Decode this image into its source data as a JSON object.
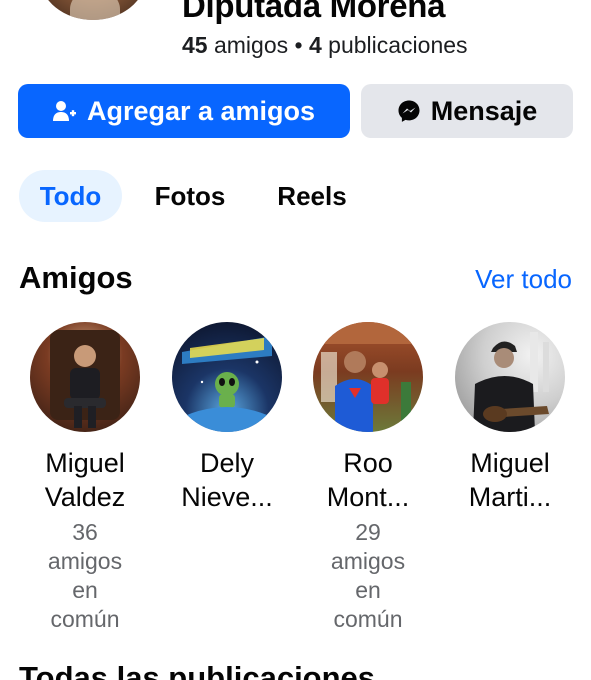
{
  "profile": {
    "name": "Diputada Morena",
    "friends_count": "45",
    "friends_label": "amigos",
    "separator": "•",
    "posts_count": "4",
    "posts_label": "publicaciones"
  },
  "actions": {
    "add_friend_label": "Agregar a amigos",
    "message_label": "Mensaje",
    "add_friend_icon": "add-friend-icon",
    "message_icon": "messenger-icon",
    "accent_color": "#0866ff"
  },
  "tabs": [
    {
      "label": "Todo",
      "active": true
    },
    {
      "label": "Fotos",
      "active": false
    },
    {
      "label": "Reels",
      "active": false
    }
  ],
  "friends_section": {
    "title": "Amigos",
    "see_all": "Ver todo",
    "friends": [
      {
        "name_line1": "Miguel",
        "name_line2": "Valdez",
        "mutual": [
          "36",
          "amigos",
          "en",
          "común"
        ]
      },
      {
        "name_line1": "Dely",
        "name_line2": "Nieve...",
        "mutual": []
      },
      {
        "name_line1": "Roo",
        "name_line2": "Mont...",
        "mutual": [
          "29",
          "amigos",
          "en",
          "común"
        ]
      },
      {
        "name_line1": "Miguel",
        "name_line2": "Marti...",
        "mutual": []
      }
    ]
  },
  "posts_section": {
    "title": "Todas las publicaciones"
  }
}
